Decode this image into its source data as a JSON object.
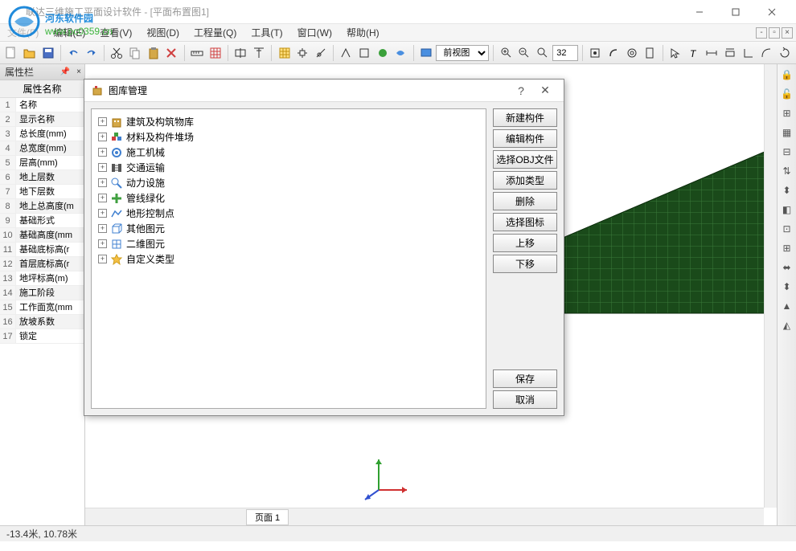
{
  "window": {
    "title": "联达三维施工平面设计软件 - [平面布置图1]"
  },
  "watermark": {
    "line1": "河东软件园",
    "line2": "www.pc0359.cn"
  },
  "menu": {
    "items": [
      "文件(F)",
      "编辑(E)",
      "查看(V)",
      "视图(D)",
      "工程量(Q)",
      "工具(T)",
      "窗口(W)",
      "帮助(H)"
    ]
  },
  "toolbar2": {
    "view_combo": "前视图",
    "zoom_value": "32"
  },
  "prop_panel": {
    "title": "属性栏",
    "col_header": "属性名称",
    "rows": [
      {
        "n": "1",
        "name": "名称"
      },
      {
        "n": "2",
        "name": "显示名称"
      },
      {
        "n": "3",
        "name": "总长度(mm)"
      },
      {
        "n": "4",
        "name": "总宽度(mm)"
      },
      {
        "n": "5",
        "name": "层高(mm)"
      },
      {
        "n": "6",
        "name": "地上层数"
      },
      {
        "n": "7",
        "name": "地下层数"
      },
      {
        "n": "8",
        "name": "地上总高度(m"
      },
      {
        "n": "9",
        "name": "基础形式"
      },
      {
        "n": "10",
        "name": "基础高度(mm"
      },
      {
        "n": "11",
        "name": "基础底标高(r"
      },
      {
        "n": "12",
        "name": "首层底标高(r"
      },
      {
        "n": "13",
        "name": "地坪标高(m)"
      },
      {
        "n": "14",
        "name": "施工阶段"
      },
      {
        "n": "15",
        "name": "工作面宽(mm"
      },
      {
        "n": "16",
        "name": "放坡系数"
      },
      {
        "n": "17",
        "name": "锁定"
      }
    ]
  },
  "canvas": {
    "page_tab": "页面 1"
  },
  "dialog": {
    "title": "图库管理",
    "tree": [
      {
        "icon": "building",
        "label": "建筑及构筑物库"
      },
      {
        "icon": "materials",
        "label": "材料及构件堆场"
      },
      {
        "icon": "machinery",
        "label": "施工机械"
      },
      {
        "icon": "transport",
        "label": "交通运输"
      },
      {
        "icon": "power",
        "label": "动力设施"
      },
      {
        "icon": "pipe",
        "label": "管线绿化"
      },
      {
        "icon": "terrain",
        "label": "地形控制点"
      },
      {
        "icon": "other3d",
        "label": "其他图元"
      },
      {
        "icon": "other2d",
        "label": "二维图元"
      },
      {
        "icon": "star",
        "label": "自定义类型"
      }
    ],
    "buttons_top": [
      "新建构件",
      "编辑构件",
      "选择OBJ文件",
      "添加类型",
      "删除",
      "选择图标",
      "上移",
      "下移"
    ],
    "buttons_bottom": [
      "保存",
      "取消"
    ]
  },
  "statusbar": {
    "coords": "-13.4米, 10.78米"
  }
}
